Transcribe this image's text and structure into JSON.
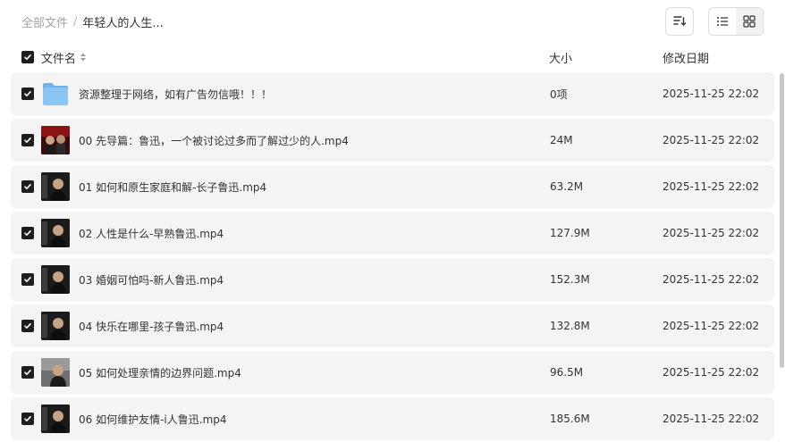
{
  "breadcrumb": {
    "root": "全部文件",
    "separator": "/",
    "current": "年轻人的人生..."
  },
  "toolbar": {
    "sort_icon": "sort-descending-icon",
    "list_view_icon": "list-view-icon",
    "grid_view_icon": "grid-view-icon",
    "active_view": "list"
  },
  "header": {
    "name": "文件名",
    "size": "大小",
    "date": "修改日期"
  },
  "rows": [
    {
      "name": "资源整理于网络，如有广告勿信哦！！！",
      "size": "0项",
      "date": "2025-11-25 22:02",
      "kind": "folder"
    },
    {
      "name": "00 先导篇：鲁迅，一个被讨论过多而了解过少的人.mp4",
      "size": "24M",
      "date": "2025-11-25 22:02",
      "kind": "video"
    },
    {
      "name": "01 如何和原生家庭和解-长子鲁迅.mp4",
      "size": "63.2M",
      "date": "2025-11-25 22:02",
      "kind": "video"
    },
    {
      "name": "02 人性是什么-早熟鲁迅.mp4",
      "size": "127.9M",
      "date": "2025-11-25 22:02",
      "kind": "video"
    },
    {
      "name": "03 婚姻可怕吗-新人鲁迅.mp4",
      "size": "152.3M",
      "date": "2025-11-25 22:02",
      "kind": "video"
    },
    {
      "name": "04 快乐在哪里-孩子鲁迅.mp4",
      "size": "132.8M",
      "date": "2025-11-25 22:02",
      "kind": "video"
    },
    {
      "name": "05 如何处理亲情的边界问题.mp4",
      "size": "96.5M",
      "date": "2025-11-25 22:02",
      "kind": "video"
    },
    {
      "name": "06 如何维护友情-i人鲁迅.mp4",
      "size": "185.6M",
      "date": "2025-11-25 22:02",
      "kind": "video"
    }
  ],
  "colors": {
    "row_bg": "#f4f4f4",
    "checkbox": "#1e1e1e",
    "folder": "#8cc4f2",
    "muted_text": "#a3a3a3"
  }
}
